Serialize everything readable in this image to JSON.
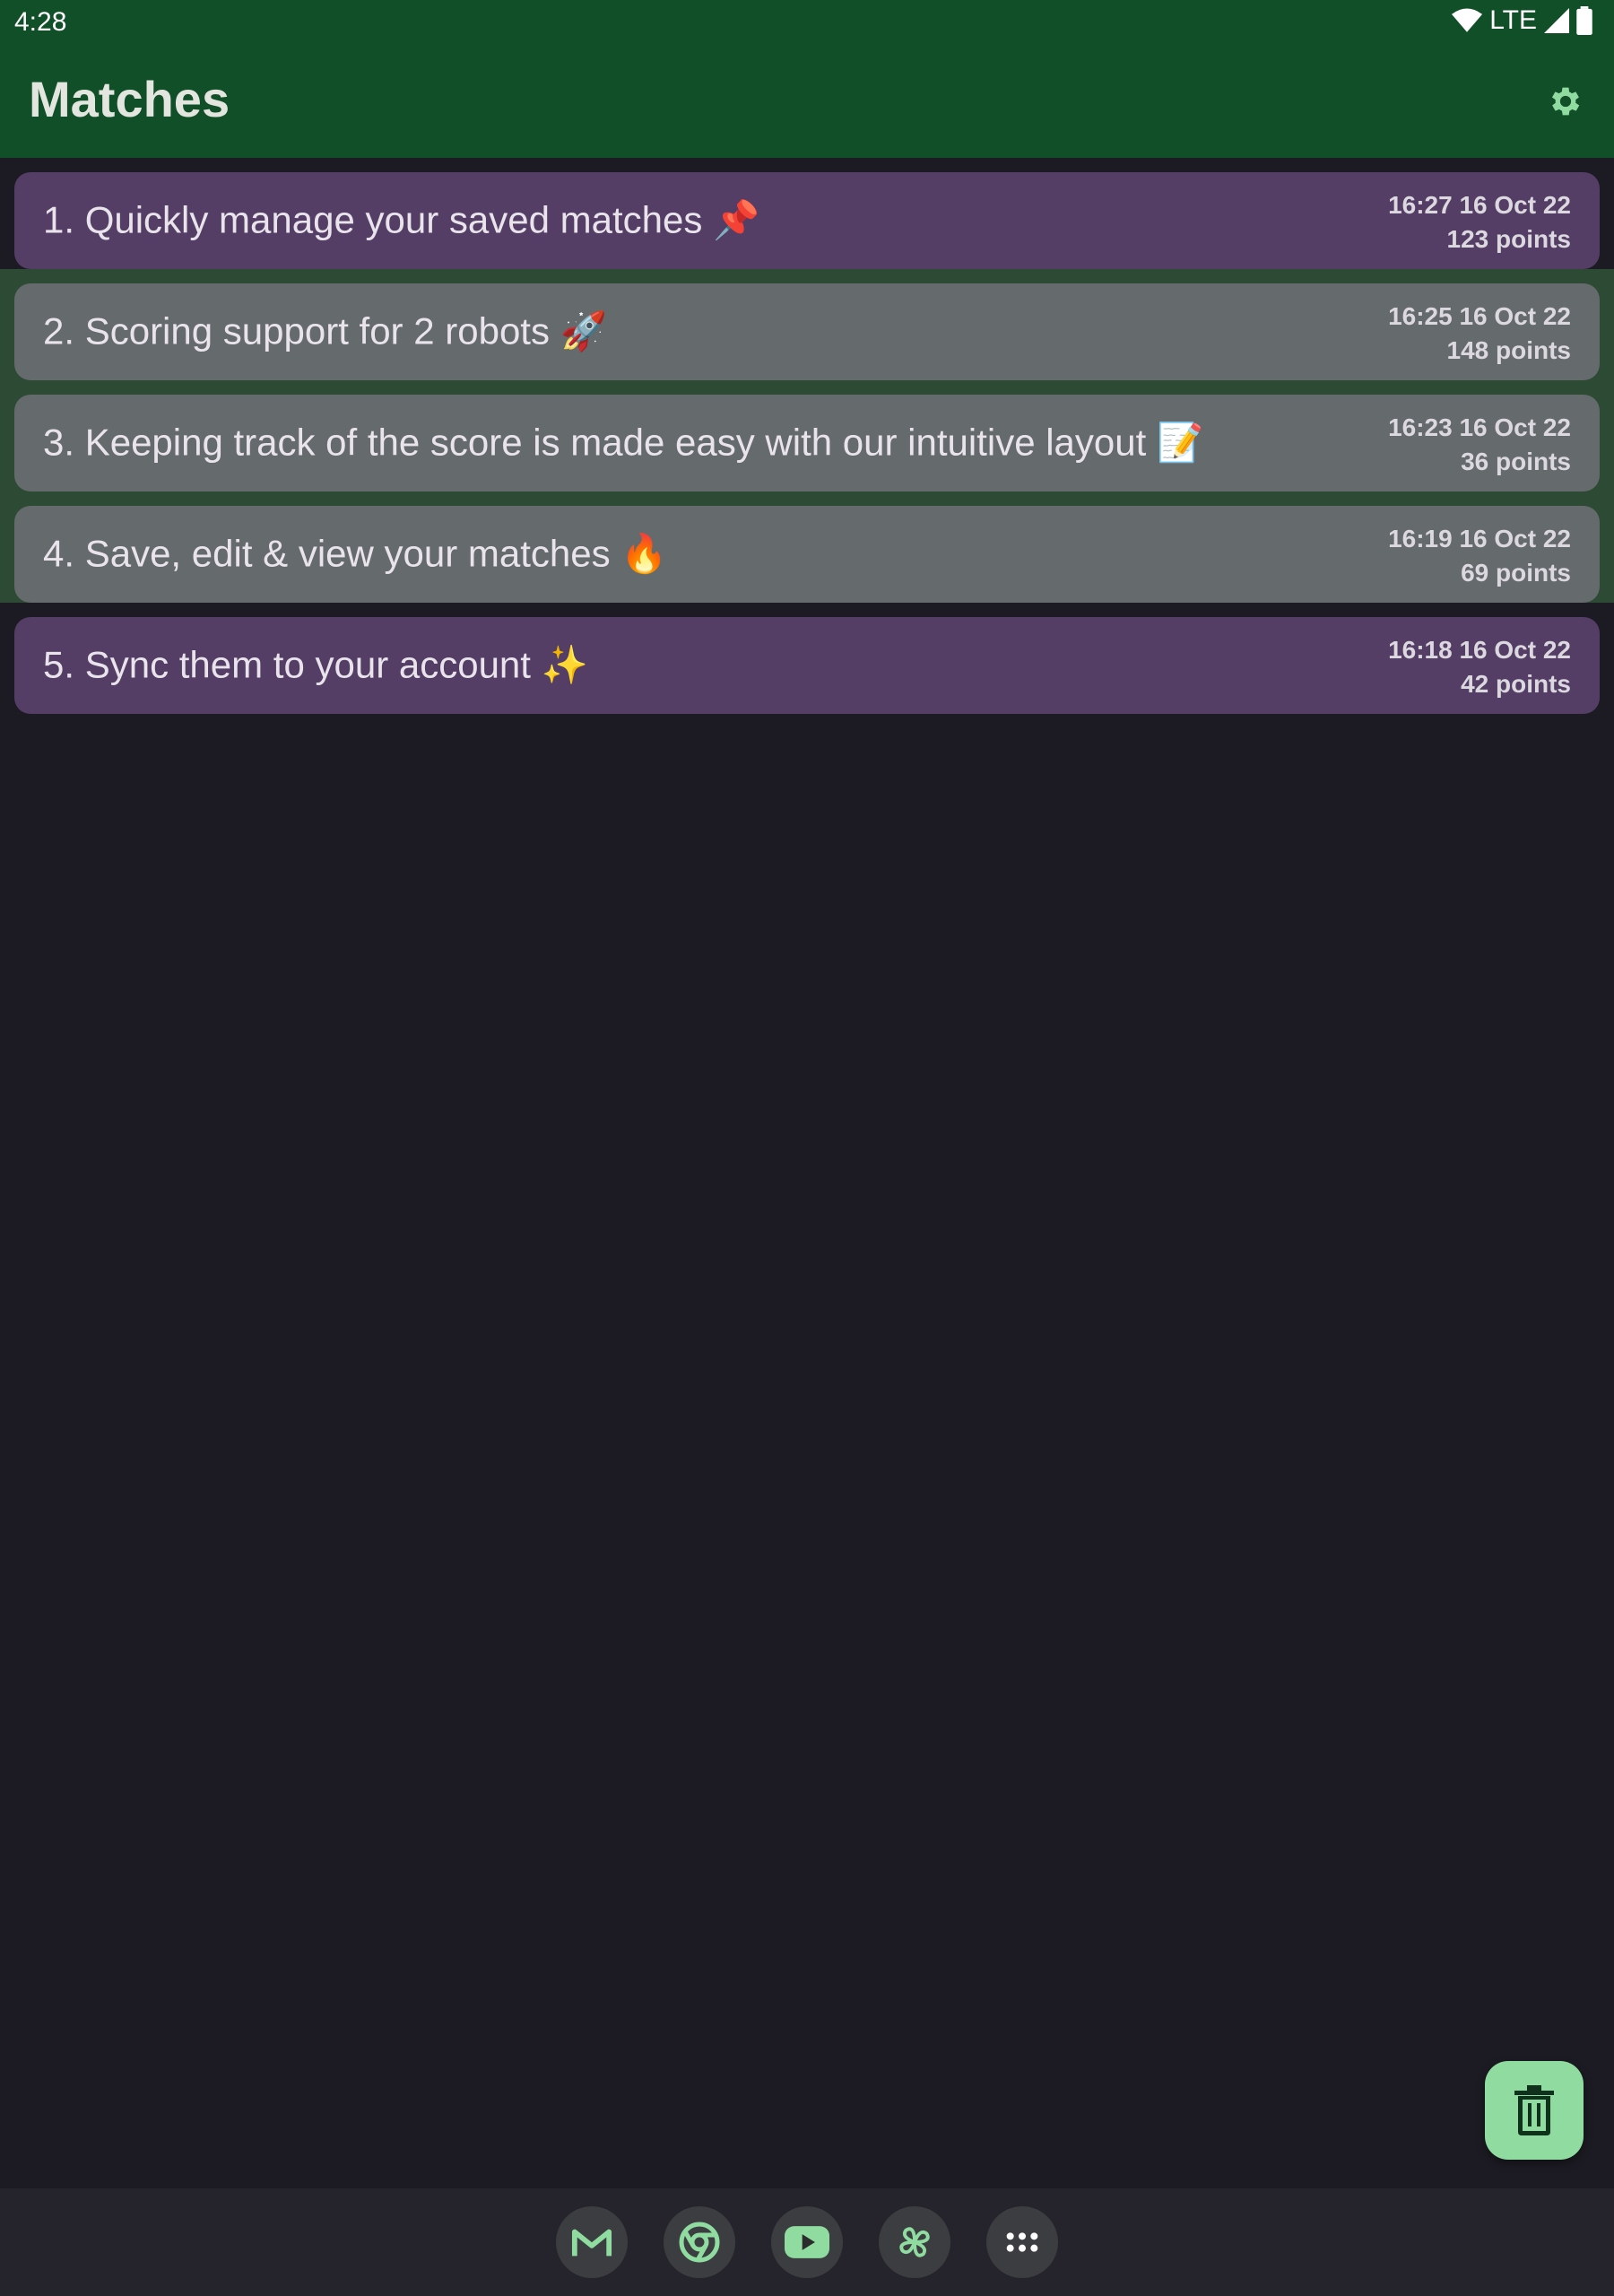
{
  "status_bar": {
    "time": "4:28",
    "network": "LTE"
  },
  "app_bar": {
    "title": "Matches"
  },
  "colors": {
    "app_bar_bg": "#114f28",
    "card_purple": "#553e65",
    "card_grey": "#656a6d",
    "fab_bg": "#90dca0",
    "accent_icon": "#90dca0"
  },
  "matches": [
    {
      "title": "1. Quickly manage your saved matches 📌",
      "datetime": "16:27 16 Oct 22",
      "points": "123 points"
    },
    {
      "title": "2. Scoring support for 2 robots 🚀",
      "datetime": "16:25 16 Oct 22",
      "points": "148 points"
    },
    {
      "title": "3. Keeping track of the score is made easy with our intuitive layout 📝",
      "datetime": "16:23 16 Oct 22",
      "points": "36 points"
    },
    {
      "title": "4. Save, edit & view your matches 🔥",
      "datetime": "16:19 16 Oct 22",
      "points": "69 points"
    },
    {
      "title": "5. Sync them to your account ✨",
      "datetime": "16:18 16 Oct 22",
      "points": "42 points"
    }
  ],
  "fab": {
    "icon": "trash-icon"
  },
  "taskbar": {
    "apps": [
      "gmail-icon",
      "chrome-icon",
      "youtube-icon",
      "pinwheel-icon",
      "app-drawer-icon"
    ]
  }
}
